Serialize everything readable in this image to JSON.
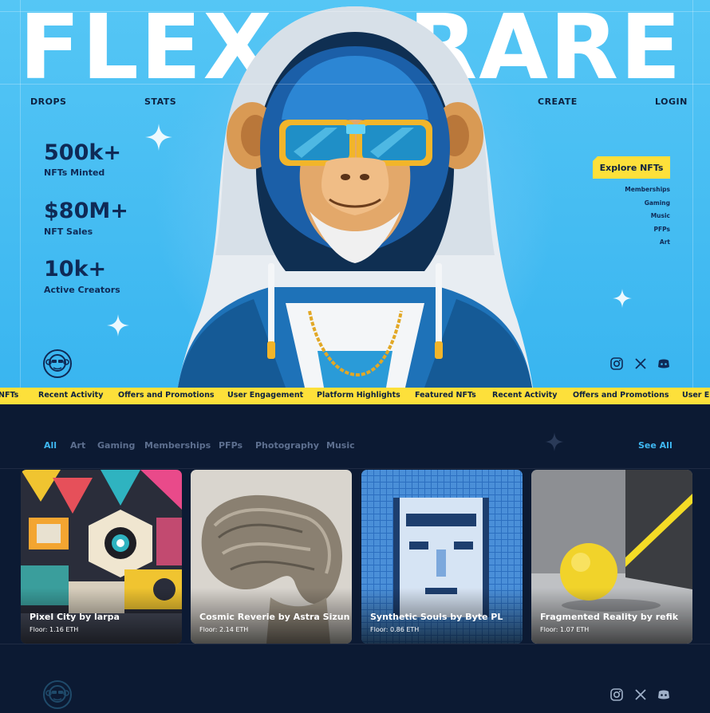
{
  "brand": {
    "left": "FLEX",
    "right": "RARE"
  },
  "nav": {
    "drops": "DROPS",
    "stats": "STATS",
    "create": "CREATE",
    "login": "LOGIN"
  },
  "stats": [
    {
      "value": "500k+",
      "label": "NFTs Minted"
    },
    {
      "value": "$80M+",
      "label": "NFT Sales"
    },
    {
      "value": "10k+",
      "label": "Active Creators"
    }
  ],
  "hero": {
    "cta_label": "Explore NFTs",
    "categories": [
      "Memberships",
      "Gaming",
      "Music",
      "PFPs",
      "Art"
    ]
  },
  "ticker": {
    "items": [
      "NFTs",
      "Recent Activity",
      "Offers and Promotions",
      "User Engagement",
      "Platform Highlights",
      "Featured NFTs",
      "Recent Activity",
      "Offers and Promotions",
      "User En"
    ]
  },
  "filters": {
    "tabs": [
      "All",
      "Art",
      "Gaming",
      "Memberships",
      "PFPs",
      "Photography",
      "Music"
    ],
    "active": "All",
    "see_all": "See All"
  },
  "cards": [
    {
      "title": "Pixel City by larpa",
      "floor": "Floor: 1.16 ETH"
    },
    {
      "title": "Cosmic Reverie by Astra Sizun",
      "floor": "Floor: 2.14 ETH"
    },
    {
      "title": "Synthetic Souls by Byte PL",
      "floor": "Floor: 0.86 ETH"
    },
    {
      "title": "Fragmented Reality by refik",
      "floor": "Floor: 1.07 ETH"
    }
  ],
  "social_icons": [
    "instagram-icon",
    "x-icon",
    "discord-icon"
  ],
  "colors": {
    "hero_bg": "#3fb8f2",
    "accent_yellow": "#fde03a",
    "dark_bg": "#0c1a33",
    "navy_text": "#0f2a56",
    "link_blue": "#3fb8f2"
  }
}
